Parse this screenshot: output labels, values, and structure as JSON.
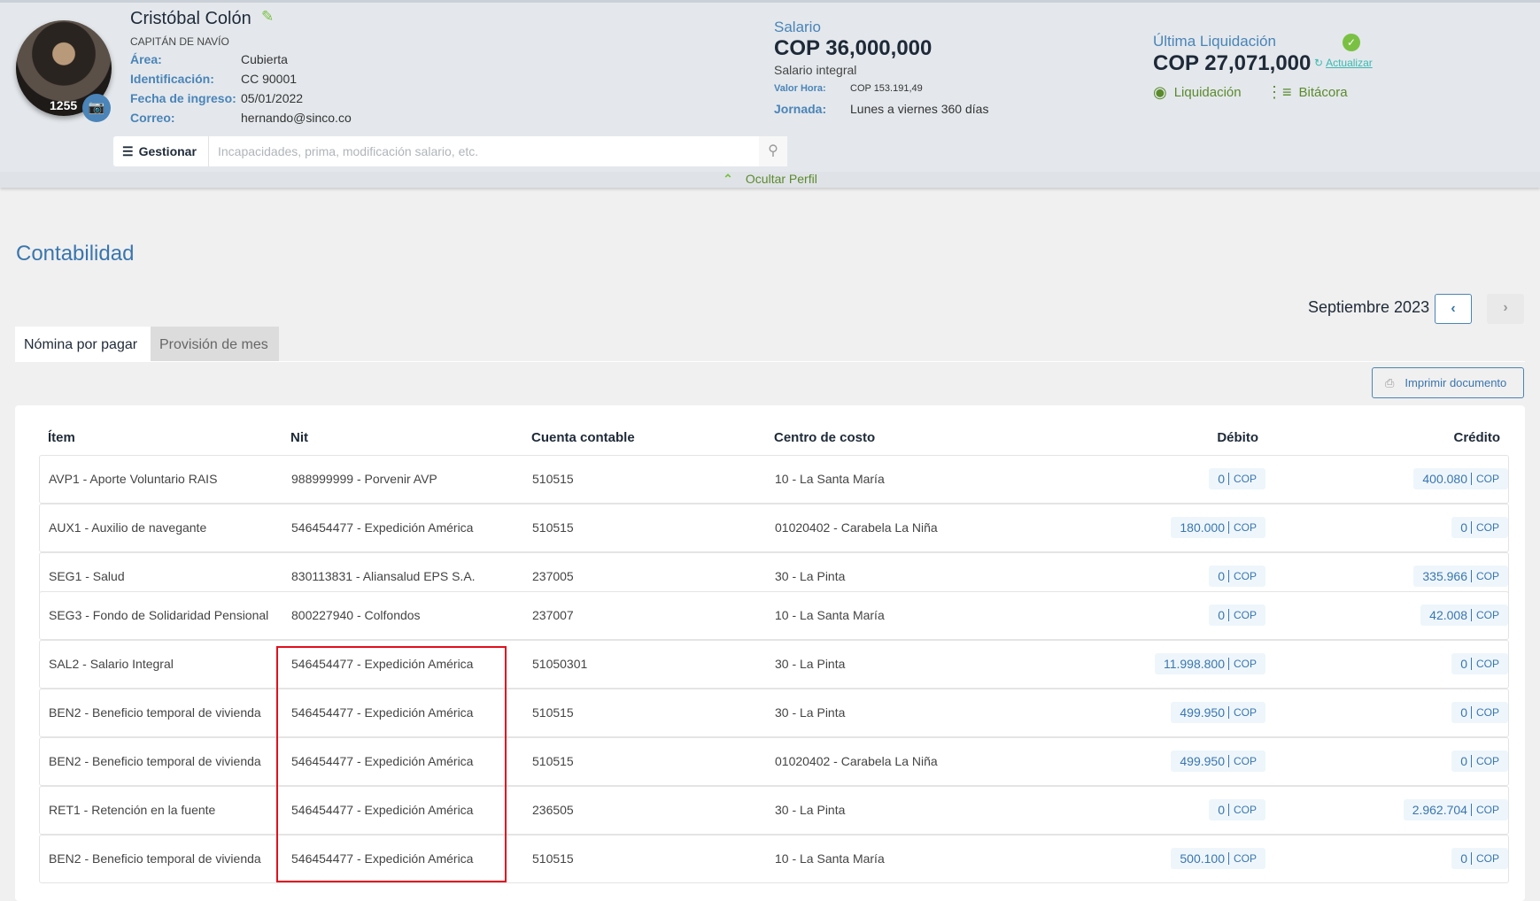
{
  "profile": {
    "badge": "1255",
    "name": "Cristóbal Colón",
    "role": "CAPITÁN DE NAVÍO",
    "fields": [
      {
        "label": "Área:",
        "value": "Cubierta"
      },
      {
        "label": "Identificación:",
        "value": "CC 90001"
      },
      {
        "label": "Fecha de ingreso:",
        "value": "05/01/2022"
      },
      {
        "label": "Correo:",
        "value": "hernando@sinco.co"
      }
    ],
    "manage_label": "Gestionar",
    "search_placeholder": "Incapacidades, prima, modificación salario, etc.",
    "hide_label": "Ocultar Perfil"
  },
  "salary": {
    "label": "Salario",
    "value": "COP 36,000,000",
    "type": "Salario integral",
    "hour_label": "Valor Hora:",
    "hour_value": "COP 153.191,49",
    "schedule_label": "Jornada:",
    "schedule_value": "Lunes a viernes 360 días"
  },
  "settlement": {
    "label": "Última Liquidación",
    "value": "COP 27,071,000",
    "refresh": "Actualizar",
    "link1": "Liquidación",
    "link2": "Bitácora"
  },
  "page": {
    "title": "Contabilidad",
    "period": "Septiembre 2023",
    "tabs": [
      "Nómina por pagar",
      "Provisión de mes"
    ],
    "print": "Imprimir documento"
  },
  "table": {
    "headers": [
      "Ítem",
      "Nit",
      "Cuenta contable",
      "Centro de costo",
      "Débito",
      "Crédito"
    ],
    "currency": "COP",
    "rows": [
      {
        "item": "AVP1 - Aporte Voluntario RAIS",
        "nit": "988999999 - Porvenir AVP",
        "cuenta": "510515",
        "centro": "10 - La Santa María",
        "debito": "0",
        "credito": "400.080"
      },
      {
        "item": "AUX1 - Auxilio de navegante",
        "nit": "546454477 - Expedición América",
        "cuenta": "510515",
        "centro": "01020402 - Carabela La Niña",
        "debito": "180.000",
        "credito": "0"
      },
      {
        "item": "SEG1 - Salud",
        "nit": "830113831 - Aliansalud EPS S.A.",
        "cuenta": "237005",
        "centro": "30 - La Pinta",
        "debito": "0",
        "credito": "335.966"
      },
      {
        "item": "SEG3 - Fondo de Solidaridad Pensional",
        "nit": "800227940 - Colfondos",
        "cuenta": "237007",
        "centro": "10 - La Santa María",
        "debito": "0",
        "credito": "42.008"
      },
      {
        "item": "SAL2 - Salario Integral",
        "nit": "546454477 - Expedición América",
        "cuenta": "51050301",
        "centro": "30 - La Pinta",
        "debito": "11.998.800",
        "credito": "0"
      },
      {
        "item": "BEN2 - Beneficio temporal de vivienda",
        "nit": "546454477 - Expedición América",
        "cuenta": "510515",
        "centro": "30 - La Pinta",
        "debito": "499.950",
        "credito": "0"
      },
      {
        "item": "BEN2 - Beneficio temporal de vivienda",
        "nit": "546454477 - Expedición América",
        "cuenta": "510515",
        "centro": "01020402 - Carabela La Niña",
        "debito": "499.950",
        "credito": "0"
      },
      {
        "item": "RET1 - Retención en la fuente",
        "nit": "546454477 - Expedición América",
        "cuenta": "236505",
        "centro": "30 - La Pinta",
        "debito": "0",
        "credito": "2.962.704"
      },
      {
        "item": "BEN2 - Beneficio temporal de vivienda",
        "nit": "546454477 - Expedición América",
        "cuenta": "510515",
        "centro": "10 - La Santa María",
        "debito": "500.100",
        "credito": "0"
      }
    ]
  },
  "colors": {
    "accent": "#3a76ae",
    "green": "#7ac143",
    "highlight": "#e0101e"
  }
}
